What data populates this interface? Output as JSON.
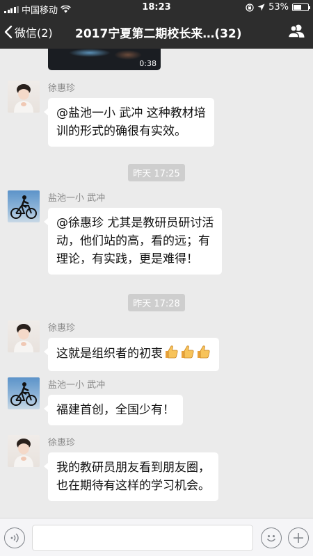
{
  "status_bar": {
    "carrier": "中国移动",
    "time": "18:23",
    "battery_percent": "53%",
    "battery_level": 0.53
  },
  "nav": {
    "back_label": "微信(2)",
    "title": "2017宁夏第二期校长来…(32)"
  },
  "video": {
    "duration": "0:38"
  },
  "messages": [
    {
      "sender": "徐惠珍",
      "avatar": "girl-avatar",
      "lines": [
        "@盐池一小 武冲 这种教材培",
        "训的形式的确很有实效。"
      ]
    },
    {
      "timestamp": "昨天 17:25"
    },
    {
      "sender": "盐池一小 武冲",
      "avatar": "cyclist-avatar",
      "lines": [
        "@徐惠珍 尤其是教研员研讨活",
        "动，他们站的高，看的远；有",
        "理论，有实践，更是难得！"
      ]
    },
    {
      "timestamp": "昨天 17:28"
    },
    {
      "sender": "徐惠珍",
      "avatar": "girl-avatar",
      "lines": [
        "这就是组织者的初衷"
      ],
      "emoji": [
        "thumbs-up-icon",
        "thumbs-up-icon",
        "thumbs-up-icon"
      ]
    },
    {
      "sender": "盐池一小 武冲",
      "avatar": "cyclist-avatar",
      "lines": [
        "福建首创，全国少有！"
      ]
    },
    {
      "sender": "徐惠珍",
      "avatar": "girl-avatar",
      "lines": [
        "我的教研员朋友看到朋友圈，",
        "也在期待有这样的学习机会。"
      ]
    }
  ],
  "input": {
    "value": "",
    "placeholder": ""
  },
  "icons": {
    "voice": "voice-icon",
    "emoji": "emoji-icon",
    "more": "plus-icon"
  },
  "colors": {
    "nav_bg": "#2d2d2d",
    "chat_bg": "#ebebeb",
    "bubble_bg": "#ffffff",
    "timestamp_bg": "#cecece"
  }
}
